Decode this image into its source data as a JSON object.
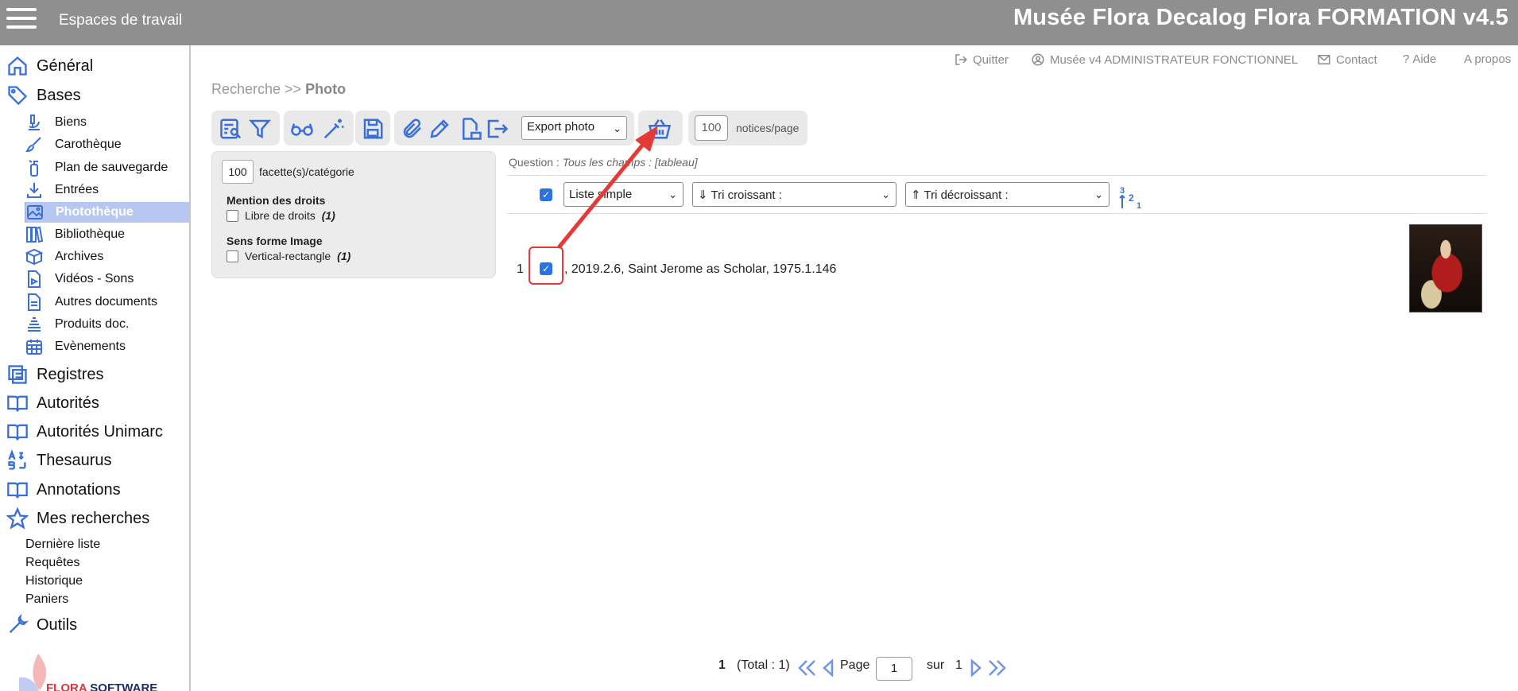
{
  "header": {
    "workspaces": "Espaces de travail",
    "title": "Musée Flora Decalog Flora FORMATION v4.5"
  },
  "sidebar": {
    "general": "Général",
    "bases": "Bases",
    "base_items": [
      "Biens",
      "Carothèque",
      "Plan de sauvegarde",
      "Entrées",
      "Photothèque",
      "Bibliothèque",
      "Archives",
      "Vidéos - Sons",
      "Autres documents",
      "Produits doc.",
      "Evènements"
    ],
    "registres": "Registres",
    "autorites": "Autorités",
    "autorites_unimarc": "Autorités Unimarc",
    "thesaurus": "Thesaurus",
    "annotations": "Annotations",
    "mes_recherches": "Mes recherches",
    "search_items": [
      "Dernière liste",
      "Requêtes",
      "Historique",
      "Paniers"
    ],
    "outils": "Outils",
    "logo_text_a": "FLORA ",
    "logo_text_b": "SOFTWARE"
  },
  "toplinks": {
    "quit": "Quitter",
    "user": "Musée v4 ADMINISTRATEUR FONCTIONNEL",
    "contact": "Contact",
    "help": "Aide",
    "about": "A propos"
  },
  "breadcrumb": {
    "root": "Recherche >> ",
    "current": "Photo"
  },
  "toolbar": {
    "export_value": "Export photo",
    "per_page": "100",
    "per_page_label": "notices/page"
  },
  "facets": {
    "per_category": "100",
    "per_category_label": "facette(s)/catégorie",
    "groups": [
      {
        "title": "Mention des droits",
        "item": "Libre de droits",
        "count": "(1)"
      },
      {
        "title": "Sens forme Image",
        "item": "Vertical-rectangle",
        "count": "(1)"
      }
    ]
  },
  "results": {
    "question_label": "Question : ",
    "question_value": "Tous les champs : [tableau]",
    "list_mode": "Liste simple",
    "sort_asc": "⇓ Tri croissant :",
    "sort_desc": "⇑ Tri décroissant :",
    "rows": [
      {
        "num": "1",
        "text": ", 2019.2.6, Saint Jerome as Scholar, 1975.1.146"
      }
    ]
  },
  "pager": {
    "current": "1",
    "total": "(Total : 1)",
    "page_label": "Page",
    "page_value": "1",
    "of_label": "sur",
    "of_value": "1"
  },
  "colors": {
    "accent": "#2b73e0",
    "icon": "#3b6fd8",
    "header_bg": "#8f8f8f",
    "active_item": "#b6c8f2",
    "annotation": "#e53935"
  }
}
